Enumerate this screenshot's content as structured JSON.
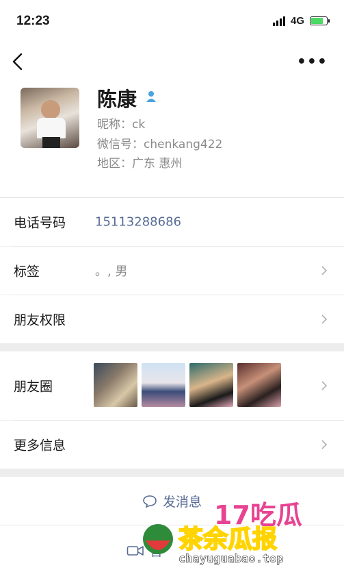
{
  "status_bar": {
    "time": "12:23",
    "network": "4G"
  },
  "profile": {
    "name": "陈康",
    "nickname": "昵称：ck",
    "wechat_id": "微信号：chenkang422",
    "region": "地区：广东 惠州"
  },
  "rows": {
    "phone_label": "电话号码",
    "phone_value": "15113288686",
    "tags_label": "标签",
    "tags_value": "。, 男",
    "friend_permissions_label": "朋友权限",
    "moments_label": "朋友圈",
    "more_info_label": "更多信息"
  },
  "actions": {
    "send_message": "发消息",
    "video_call": "音"
  },
  "watermark": {
    "text": "茶余瓜报",
    "domain": "chayuguabao.top",
    "overlay": "17吃瓜"
  },
  "colors": {
    "link": "#576b95",
    "background": "#ededed",
    "battery": "#4cd964"
  }
}
